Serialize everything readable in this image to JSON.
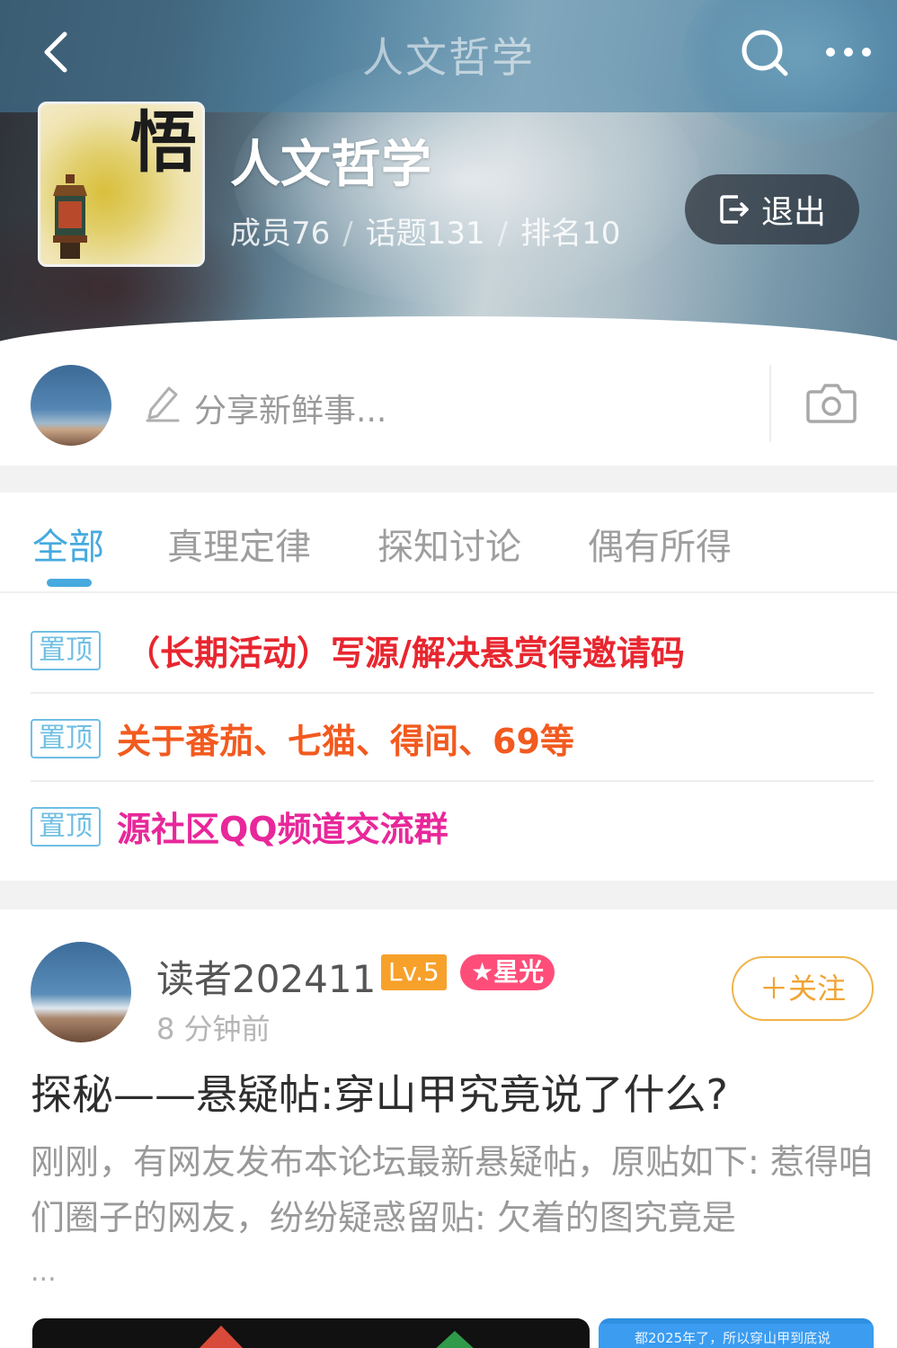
{
  "header": {
    "title": "人文哲学",
    "group_name": "人文哲学",
    "avatar_char": "悟",
    "stats": {
      "members": "成员76",
      "topics": "话题131",
      "rank": "排名10",
      "separator": "/"
    },
    "quit_label": "退出"
  },
  "share": {
    "placeholder": "分享新鲜事..."
  },
  "tabs": [
    {
      "label": "全部",
      "active": true
    },
    {
      "label": "真理定律",
      "active": false
    },
    {
      "label": "探知讨论",
      "active": false
    },
    {
      "label": "偶有所得",
      "active": false
    }
  ],
  "pinned": [
    {
      "badge": "置顶",
      "text": "（长期活动）写源/解决悬赏得邀请码",
      "color": "#e8262f"
    },
    {
      "badge": "置顶",
      "text": "关于番茄、七猫、得间、69等",
      "color": "#f25a1f"
    },
    {
      "badge": "置顶",
      "text": "源社区QQ频道交流群",
      "color": "#e8279a"
    }
  ],
  "post": {
    "author": "读者202411",
    "level": "Lv.5",
    "star_badge": "★星光",
    "time": "8 分钟前",
    "follow_label": "＋关注",
    "title": "探秘——悬疑帖:穿山甲究竟说了什么?",
    "excerpt": "刚刚，有网友发布本论坛最新悬疑帖，原贴如下: 惹得咱们圈子的网友，纷纷疑惑留贴: 欠着的图究竟是",
    "ellipsis": "...",
    "thumb_right_text": "都2025年了，所以穿山甲到底说"
  },
  "colors": {
    "accent": "#46aadf",
    "follow": "#f0a433",
    "level_badge": "#f7a12b",
    "star_badge": "#ff4d79"
  },
  "icons": [
    "back-icon",
    "search-icon",
    "more-icon",
    "exit-icon",
    "edit-icon",
    "camera-icon"
  ]
}
